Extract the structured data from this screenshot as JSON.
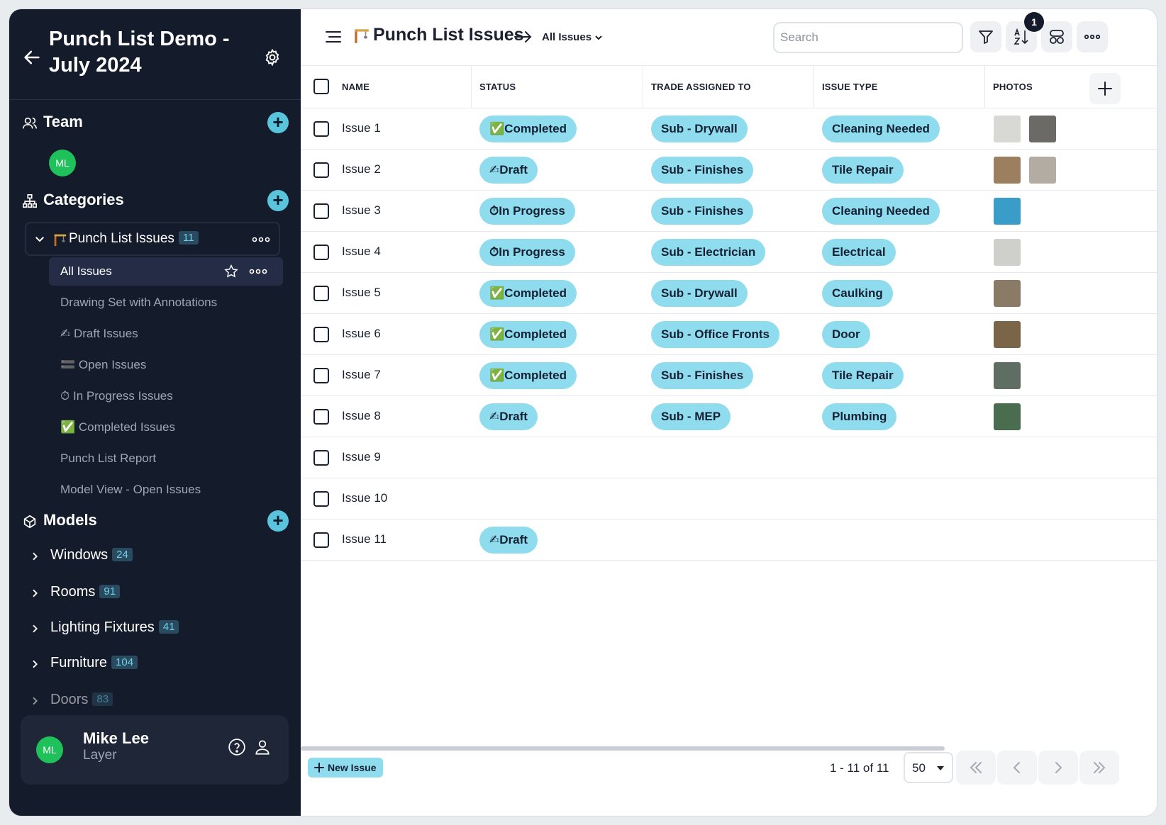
{
  "project": {
    "title": "Punch List Demo - July 2024"
  },
  "team": {
    "label": "Team",
    "members": [
      {
        "initials": "ML"
      }
    ]
  },
  "categories": {
    "label": "Categories",
    "group": {
      "name": "Punch List Issues",
      "count": "11"
    },
    "active_view": "All Issues",
    "views": [
      "Drawing Set with Annotations",
      "✍ Draft Issues",
      "🟰 Open Issues",
      "⏱ In Progress Issues",
      "✅ Completed Issues",
      "Punch List Report",
      "Model View - Open Issues"
    ]
  },
  "models": {
    "label": "Models",
    "items": [
      {
        "name": "Windows",
        "count": "24"
      },
      {
        "name": "Rooms",
        "count": "91"
      },
      {
        "name": "Lighting Fixtures",
        "count": "41"
      },
      {
        "name": "Furniture",
        "count": "104"
      },
      {
        "name": "Doors",
        "count": "83"
      }
    ]
  },
  "user": {
    "initials": "ML",
    "name": "Mike Lee",
    "subtitle": "Layer"
  },
  "header": {
    "title": "Punch List Issues",
    "view": "All Issues",
    "search_placeholder": "Search",
    "sort_badge": "1"
  },
  "table": {
    "columns": [
      "NAME",
      "STATUS",
      "TRADE ASSIGNED TO",
      "ISSUE TYPE",
      "PHOTOS"
    ],
    "rows": [
      {
        "name": "Issue 1",
        "status": "✅Completed",
        "trade": "Sub - Drywall",
        "type": "Cleaning Needed",
        "photos": [
          "#d8d8d4",
          "#6b6a66"
        ]
      },
      {
        "name": "Issue 2",
        "status": "✍Draft",
        "trade": "Sub - Finishes",
        "type": "Tile Repair",
        "photos": [
          "#9c7f5e",
          "#b3aca2"
        ]
      },
      {
        "name": "Issue 3",
        "status": "⏱In Progress",
        "trade": "Sub - Finishes",
        "type": "Cleaning Needed",
        "photos": [
          "#3a9cc9"
        ]
      },
      {
        "name": "Issue 4",
        "status": "⏱In Progress",
        "trade": "Sub - Electrician",
        "type": "Electrical",
        "photos": [
          "#cfcfcb"
        ]
      },
      {
        "name": "Issue 5",
        "status": "✅Completed",
        "trade": "Sub - Drywall",
        "type": "Caulking",
        "photos": [
          "#8a7b66"
        ]
      },
      {
        "name": "Issue 6",
        "status": "✅Completed",
        "trade": "Sub - Office Fronts",
        "type": "Door",
        "photos": [
          "#7a6548"
        ]
      },
      {
        "name": "Issue 7",
        "status": "✅Completed",
        "trade": "Sub - Finishes",
        "type": "Tile Repair",
        "photos": [
          "#5f6e62"
        ]
      },
      {
        "name": "Issue 8",
        "status": "✍Draft",
        "trade": "Sub - MEP",
        "type": "Plumbing",
        "photos": [
          "#4a6d50"
        ]
      },
      {
        "name": "Issue 9",
        "status": "",
        "trade": "",
        "type": "",
        "photos": []
      },
      {
        "name": "Issue 10",
        "status": "",
        "trade": "",
        "type": "",
        "photos": []
      },
      {
        "name": "Issue 11",
        "status": "✍Draft",
        "trade": "",
        "type": "",
        "photos": []
      }
    ]
  },
  "footer": {
    "new_issue_label": "New Issue",
    "page_info": "1 - 11 of 11",
    "page_size": "50"
  },
  "colors": {
    "sidebar": "#141b2b",
    "accent": "#8fdcef",
    "add": "#5bc4dd",
    "avatar": "#1fc15a"
  }
}
